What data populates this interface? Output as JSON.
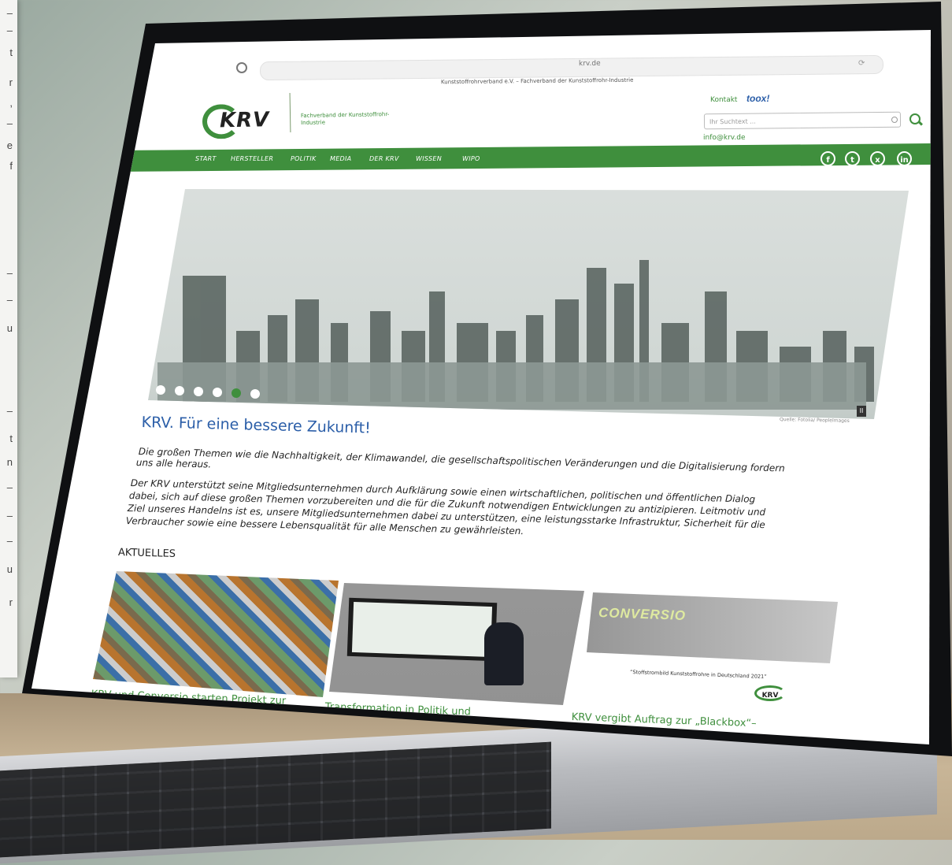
{
  "browser": {
    "url": "krv.de",
    "tab_title": "Kunststoffrohrverband e.V. – Fachverband der Kunststoffrohr-Industrie"
  },
  "header": {
    "logo_text": "KRV",
    "logo_subtitle": "Fachverband der Kunststoffrohr-Industrie",
    "kontakt": "Kontakt",
    "toolbox": "toox!",
    "search_placeholder": "Ihr Suchtext ...",
    "email": "info@krv.de"
  },
  "nav": {
    "items": [
      "START",
      "HERSTELLER",
      "POLITIK",
      "MEDIA",
      "DER KRV",
      "WISSEN",
      "WIPO"
    ],
    "social": [
      "facebook-icon",
      "twitter-icon",
      "xing-icon",
      "linkedin-icon"
    ]
  },
  "hero": {
    "credit": "Quelle: Fotolia/ Peoplelmages",
    "slides": 6,
    "active_slide": 5
  },
  "main": {
    "headline": "KRV. Für eine bessere Zukunft!",
    "intro": [
      "Die großen Themen wie die Nachhaltigkeit, der Klimawandel, die gesellschaftspolitischen Veränderungen und die Digitalisierung fordern",
      "uns alle heraus."
    ],
    "body": [
      "Der KRV unterstützt seine Mitgliedsunternehmen durch Aufklärung sowie einen wirtschaftlichen, politischen und öffentlichen Dialog",
      "dabei, sich auf diese großen Themen vorzubereiten und die für die Zukunft notwendigen Entwicklungen zu antizipieren. Leitmotiv und",
      "Ziel unseres Handelns ist es, unsere Mitgliedsunternehmen dabei zu unterstützen, eine leistungsstarke Infrastruktur, Sicherheit für die",
      "Verbraucher sowie eine bessere Lebensqualität für alle Menschen zu gewährleisten."
    ],
    "section_title": "AKTUELLES"
  },
  "news": [
    {
      "title": "KRV und Conversio starten Projekt zur"
    },
    {
      "title": "Transformation in Politik und"
    },
    {
      "title": "KRV vergibt Auftrag zur „Blackbox“–",
      "brand": "CONVERSIO",
      "caption": "“Stoffstrombild Kunststoffrohre in Deutschland 2021”"
    }
  ],
  "colors": {
    "brand_green": "#3f8f3d",
    "headline_blue": "#2b5ea8"
  }
}
